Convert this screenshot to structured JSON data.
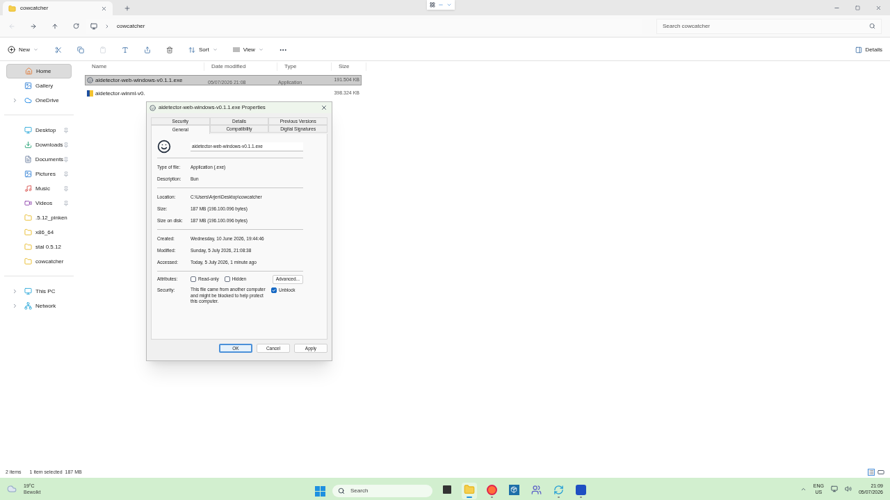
{
  "window": {
    "tab_title": "cowcatcher",
    "path": [
      "cowcatcher"
    ],
    "search_placeholder": "Search cowcatcher"
  },
  "toolbar": {
    "new_label": "New",
    "sort_label": "Sort",
    "view_label": "View",
    "details_label": "Details",
    "paste_disabled": true
  },
  "sidebar": {
    "sections": [
      [
        {
          "kind": "home",
          "label": "Home",
          "selected": true,
          "expandable": false,
          "pinned": false
        },
        {
          "kind": "gallery",
          "label": "Gallery",
          "selected": false,
          "expandable": false,
          "pinned": false
        },
        {
          "kind": "cloud",
          "label": "OneDrive",
          "selected": false,
          "expandable": true,
          "pinned": false
        }
      ],
      [
        {
          "kind": "desktop",
          "label": "Desktop",
          "selected": false,
          "expandable": false,
          "pinned": true
        },
        {
          "kind": "download",
          "label": "Downloads",
          "selected": false,
          "expandable": false,
          "pinned": true
        },
        {
          "kind": "documents",
          "label": "Documents",
          "selected": false,
          "expandable": false,
          "pinned": true
        },
        {
          "kind": "pictures",
          "label": "Pictures",
          "selected": false,
          "expandable": false,
          "pinned": true
        },
        {
          "kind": "music",
          "label": "Music",
          "selected": false,
          "expandable": false,
          "pinned": true
        },
        {
          "kind": "videos",
          "label": "Videos",
          "selected": false,
          "expandable": false,
          "pinned": true
        },
        {
          "kind": "folder",
          "label": ".5.12_pinken",
          "selected": false,
          "expandable": false,
          "pinned": false
        },
        {
          "kind": "folder",
          "label": "x86_64",
          "selected": false,
          "expandable": false,
          "pinned": false
        },
        {
          "kind": "folder",
          "label": "stal 0.5.12",
          "selected": false,
          "expandable": false,
          "pinned": false
        },
        {
          "kind": "folder",
          "label": "cowcatcher",
          "selected": false,
          "expandable": false,
          "pinned": false
        }
      ],
      [
        {
          "kind": "pc",
          "label": "This PC",
          "selected": false,
          "expandable": true,
          "pinned": false
        },
        {
          "kind": "network",
          "label": "Network",
          "selected": false,
          "expandable": true,
          "pinned": false
        }
      ]
    ]
  },
  "file_list": {
    "columns": [
      "Name",
      "Date modified",
      "Type",
      "Size"
    ],
    "rows": [
      {
        "kind": "app",
        "name": "aidetector-web-windows-v0.1.1.exe",
        "date": "05/07/2026 21:08",
        "type": "Application",
        "size": "191.504 KB",
        "selected": true
      },
      {
        "kind": "installer",
        "name": "aidetector-winml-v0.",
        "size": "398.324 KB",
        "selected": false
      }
    ]
  },
  "dialog": {
    "title": "aidetector-web-windows-v0.1.1.exe Properties",
    "tab_rows": [
      [
        {
          "label": "Security",
          "selected": false
        },
        {
          "label": "Details",
          "selected": false
        },
        {
          "label": "Previous Versions",
          "selected": false
        }
      ],
      [
        {
          "label": "General",
          "selected": true
        },
        {
          "label": "Compatibility",
          "selected": false
        },
        {
          "label": "Digital Signatures",
          "selected": false
        }
      ]
    ],
    "file_name": "aidetector-web-windows-v0.1.1.exe",
    "groups": [
      [
        {
          "label": "Type of file:",
          "value": "Application (.exe)"
        },
        {
          "label": "Description:",
          "value": "Bun"
        }
      ],
      [
        {
          "label": "Location:",
          "value": "C:\\Users\\Arjen\\Desktop\\cowcatcher"
        },
        {
          "label": "Size:",
          "value": "187 MB (196.100.096 bytes)"
        },
        {
          "label": "Size on disk:",
          "value": "187 MB (196.100.096 bytes)"
        }
      ],
      [
        {
          "label": "Created:",
          "value": "Wednesday, 10 June 2026, 19:44:46"
        },
        {
          "label": "Modified:",
          "value": "Sunday, 5 July 2026, 21:08:38"
        },
        {
          "label": "Accessed:",
          "value": "Today, 5 July 2026, 1 minute ago"
        }
      ]
    ],
    "attributes": {
      "label": "Attributes:",
      "checkboxes": [
        {
          "label": "Read-only",
          "checked": false
        },
        {
          "label": "Hidden",
          "checked": false
        }
      ],
      "advanced": "Advanced..."
    },
    "security": {
      "label": "Security:",
      "text": "This file came from another computer and might be blocked to help protect this computer.",
      "unblock": {
        "label": "Unblock",
        "checked": true
      }
    },
    "buttons": [
      {
        "label": "OK",
        "default": true
      },
      {
        "label": "Cancel",
        "default": false
      },
      {
        "label": "Apply",
        "default": false
      }
    ]
  },
  "status_bar": {
    "items": "2 items",
    "selection": "1 item selected  187 MB"
  },
  "taskbar": {
    "temperature": "19°C",
    "condition": "Bewolkt",
    "search_placeholder": "Search",
    "apps": [
      {
        "kind": "taskview",
        "running": false,
        "selected": false
      },
      {
        "kind": "explorer",
        "running": true,
        "selected": true
      },
      {
        "kind": "firefox",
        "running": true,
        "selected": false
      },
      {
        "kind": "bull",
        "running": false,
        "selected": false
      },
      {
        "kind": "teams",
        "running": false,
        "selected": false
      },
      {
        "kind": "sync",
        "running": true,
        "selected": false
      },
      {
        "kind": "rdp",
        "running": true,
        "selected": false
      }
    ],
    "language": "ENG",
    "region": "US",
    "time": "21:09",
    "date": "05/07/2026"
  }
}
